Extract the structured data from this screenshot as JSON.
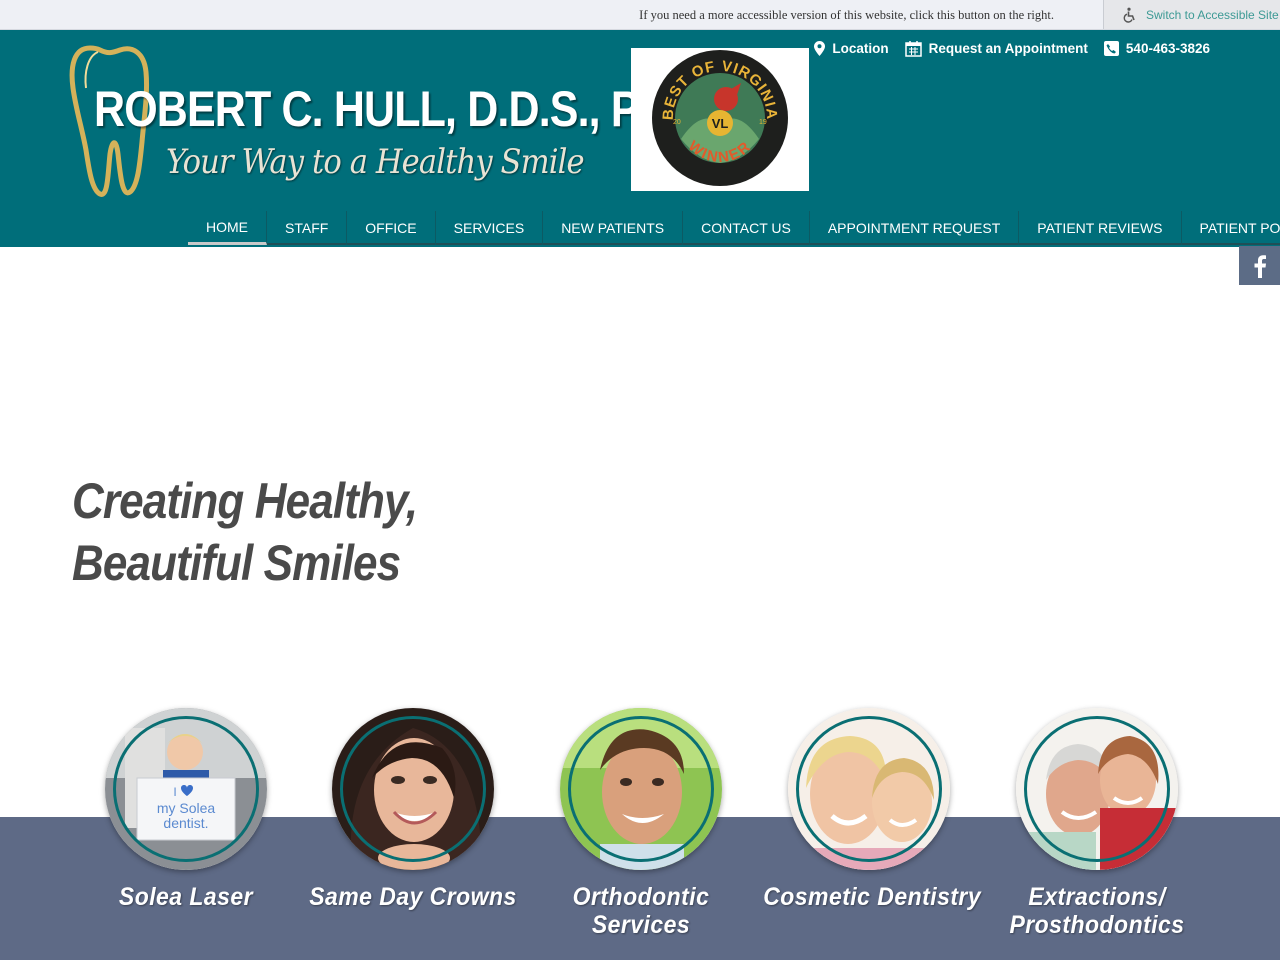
{
  "accessibility_bar": {
    "message": "If you need a more accessible version of this website, click this button on the right.",
    "button_label": "Switch to Accessible Site"
  },
  "logo": {
    "name": "ROBERT C. HULL, D.D.S., P.C.",
    "tagline": "Your Way to a Healthy Smile"
  },
  "award": {
    "top_text": "BEST OF VIRGINIA",
    "bottom_text": "WINNER",
    "monogram": "VL",
    "year_left": "20",
    "year_right": "19"
  },
  "utility_links": [
    {
      "label": "Location",
      "icon": "map-pin-icon"
    },
    {
      "label": "Request an Appointment",
      "icon": "calendar-icon"
    },
    {
      "label": "540-463-3826",
      "icon": "phone-icon"
    }
  ],
  "nav": [
    {
      "label": "HOME",
      "active": true
    },
    {
      "label": "STAFF"
    },
    {
      "label": "OFFICE"
    },
    {
      "label": "SERVICES"
    },
    {
      "label": "NEW PATIENTS"
    },
    {
      "label": "CONTACT US"
    },
    {
      "label": "APPOINTMENT REQUEST"
    },
    {
      "label": "PATIENT REVIEWS"
    },
    {
      "label": "PATIENT PORTAL"
    }
  ],
  "social": {
    "icon": "facebook-icon"
  },
  "hero": {
    "line1": "Creating Healthy,",
    "line2": "Beautiful Smiles"
  },
  "solea_sign": {
    "line1": "I",
    "line2": "my Solea",
    "line3": "dentist."
  },
  "services": [
    {
      "line1": "Solea Laser",
      "line2": ""
    },
    {
      "line1": "Same Day Crowns",
      "line2": ""
    },
    {
      "line1": "Orthodontic",
      "line2": "Services"
    },
    {
      "line1": "Cosmetic Dentistry",
      "line2": ""
    },
    {
      "line1": "Extractions/",
      "line2": "Prosthodontics"
    }
  ],
  "colors": {
    "header": "#006e7a",
    "band": "#5e6a86",
    "accent_ring": "#0a6f73",
    "hero_text": "#4a4a4a"
  }
}
